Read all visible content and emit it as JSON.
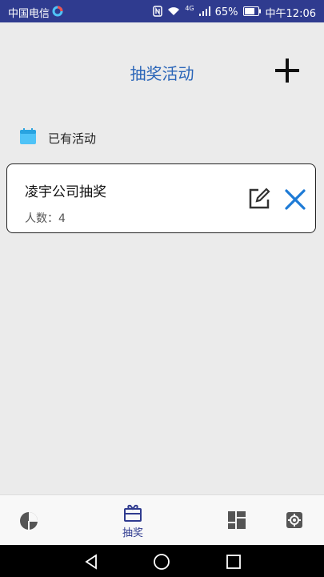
{
  "status_bar": {
    "carrier": "中国电信",
    "network": "4G",
    "battery": "65%",
    "time": "中午12:06"
  },
  "header": {
    "title": "抽奖活动",
    "add_icon": "plus-icon"
  },
  "section": {
    "label": "已有活动",
    "icon": "calendar-icon"
  },
  "activities": [
    {
      "name": "凌宇公司抽奖",
      "count_label": "人数：",
      "count": "4",
      "edit_icon": "edit-icon",
      "delete_icon": "close-icon"
    }
  ],
  "tabbar": {
    "tabs": [
      {
        "icon": "pie-chart-icon",
        "label": ""
      },
      {
        "icon": "gift-box-icon",
        "label": "抽奖",
        "active": true
      },
      {
        "icon": "dashboard-icon",
        "label": ""
      },
      {
        "icon": "gear-icon",
        "label": ""
      }
    ],
    "active_color": "#2f3b8f"
  },
  "colors": {
    "status_bar": "#2f3b8f",
    "title": "#2a65b8",
    "accent_close": "#1e7bd6",
    "background": "#ebebeb"
  }
}
